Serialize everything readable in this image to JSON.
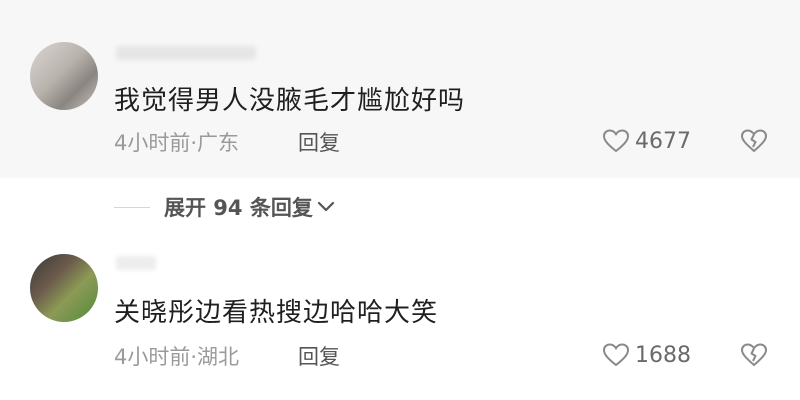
{
  "comments": [
    {
      "text": "我觉得男人没腋毛才尴尬好吗",
      "meta": "4小时前·广东",
      "reply_label": "回复",
      "likes": "4677"
    },
    {
      "text": "关晓彤边看热搜边哈哈大笑",
      "meta": "4小时前·湖北",
      "reply_label": "回复",
      "likes": "1688"
    }
  ],
  "expand_replies": {
    "label": "展开 94 条回复"
  },
  "icons": {
    "like": "heart-outline-icon",
    "dislike": "broken-heart-icon",
    "expand": "chevron-down-icon"
  },
  "colors": {
    "text": "#1f1f1f",
    "meta": "#9a9a9a",
    "highlight_bg": "#f7f7f7"
  }
}
